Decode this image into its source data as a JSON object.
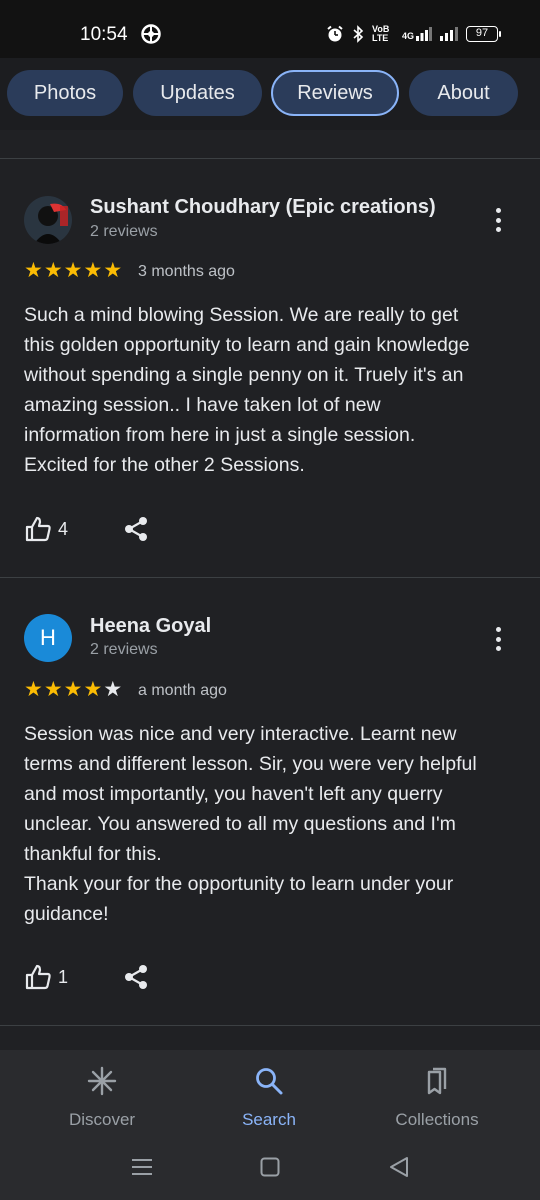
{
  "status_bar": {
    "time": "10:54",
    "network_label": "VoB LTE",
    "signal_label": "4G",
    "battery": "97"
  },
  "tabs": [
    {
      "label": "Photos"
    },
    {
      "label": "Updates"
    },
    {
      "label": "Reviews",
      "active": true
    },
    {
      "label": "About"
    }
  ],
  "reviews": [
    {
      "name": "Sushant Choudhary (Epic creations)",
      "count": "2 reviews",
      "rating": 5,
      "date": "3 months ago",
      "text": "Such a mind blowing Session. We are really to get\nthis golden opportunity to learn and gain knowledge\nwithout spending a single penny on it. Truely it's an\namazing session.. I have taken lot of new\ninformation from here in just a single session.\nExcited for the other 2 Sessions.",
      "likes": "4",
      "avatar": "photo"
    },
    {
      "name": "Heena Goyal",
      "count": "2 reviews",
      "rating": 4,
      "date": "a month ago",
      "text": "Session was nice and very interactive. Learnt new\nterms and different lesson. Sir, you were very helpful\nand most importantly, you haven't left any querry\nunclear. You answered to all my questions and I'm\nthankful for this.\nThank your for the opportunity to learn under your\nguidance!",
      "likes": "1",
      "avatar_letter": "H"
    }
  ],
  "bottom_nav": [
    {
      "label": "Discover",
      "icon": "asterisk-icon"
    },
    {
      "label": "Search",
      "icon": "search-icon",
      "active": true
    },
    {
      "label": "Collections",
      "icon": "collections-icon"
    }
  ],
  "colors": {
    "accent": "#8ab4f8",
    "star": "#fbbc04",
    "background": "#202124",
    "tab": "#2b3c5a",
    "avatar_h": "#1a8ad8"
  }
}
